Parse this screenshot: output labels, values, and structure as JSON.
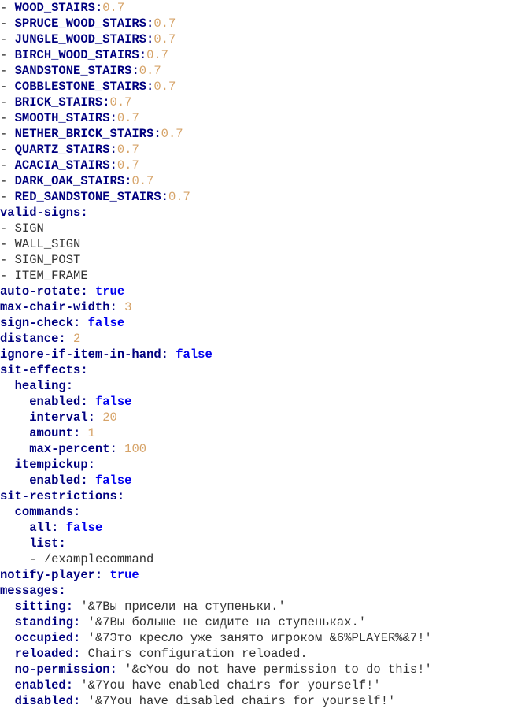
{
  "document": {
    "type": "yaml-config",
    "file_kind": "Chairs plugin configuration",
    "colors": {
      "key": "#000080",
      "boolean": "#0000ee",
      "number": "#d6a368",
      "string": "#333333",
      "background": "#ffffff"
    },
    "lines": [
      {
        "indent": 0,
        "bullet": "-",
        "key": "WOOD_STAIRS",
        "sep": ":",
        "value": "0.7",
        "vtype": "number"
      },
      {
        "indent": 0,
        "bullet": "-",
        "key": "SPRUCE_WOOD_STAIRS",
        "sep": ":",
        "value": "0.7",
        "vtype": "number"
      },
      {
        "indent": 0,
        "bullet": "-",
        "key": "JUNGLE_WOOD_STAIRS",
        "sep": ":",
        "value": "0.7",
        "vtype": "number"
      },
      {
        "indent": 0,
        "bullet": "-",
        "key": "BIRCH_WOOD_STAIRS",
        "sep": ":",
        "value": "0.7",
        "vtype": "number"
      },
      {
        "indent": 0,
        "bullet": "-",
        "key": "SANDSTONE_STAIRS",
        "sep": ":",
        "value": "0.7",
        "vtype": "number"
      },
      {
        "indent": 0,
        "bullet": "-",
        "key": "COBBLESTONE_STAIRS",
        "sep": ":",
        "value": "0.7",
        "vtype": "number"
      },
      {
        "indent": 0,
        "bullet": "-",
        "key": "BRICK_STAIRS",
        "sep": ":",
        "value": "0.7",
        "vtype": "number"
      },
      {
        "indent": 0,
        "bullet": "-",
        "key": "SMOOTH_STAIRS",
        "sep": ":",
        "value": "0.7",
        "vtype": "number"
      },
      {
        "indent": 0,
        "bullet": "-",
        "key": "NETHER_BRICK_STAIRS",
        "sep": ":",
        "value": "0.7",
        "vtype": "number"
      },
      {
        "indent": 0,
        "bullet": "-",
        "key": "QUARTZ_STAIRS",
        "sep": ":",
        "value": "0.7",
        "vtype": "number"
      },
      {
        "indent": 0,
        "bullet": "-",
        "key": "ACACIA_STAIRS",
        "sep": ":",
        "value": "0.7",
        "vtype": "number"
      },
      {
        "indent": 0,
        "bullet": "-",
        "key": "DARK_OAK_STAIRS",
        "sep": ":",
        "value": "0.7",
        "vtype": "number"
      },
      {
        "indent": 0,
        "bullet": "-",
        "key": "RED_SANDSTONE_STAIRS",
        "sep": ":",
        "value": "0.7",
        "vtype": "number"
      },
      {
        "indent": 0,
        "bullet": "",
        "key": "valid-signs",
        "sep": ":",
        "value": "",
        "vtype": "none"
      },
      {
        "indent": 0,
        "bullet": "-",
        "key": "",
        "sep": "",
        "value": "SIGN",
        "vtype": "item"
      },
      {
        "indent": 0,
        "bullet": "-",
        "key": "",
        "sep": "",
        "value": "WALL_SIGN",
        "vtype": "item"
      },
      {
        "indent": 0,
        "bullet": "-",
        "key": "",
        "sep": "",
        "value": "SIGN_POST",
        "vtype": "item"
      },
      {
        "indent": 0,
        "bullet": "-",
        "key": "",
        "sep": "",
        "value": "ITEM_FRAME",
        "vtype": "item"
      },
      {
        "indent": 0,
        "bullet": "",
        "key": "auto-rotate",
        "sep": ": ",
        "value": "true",
        "vtype": "boolean"
      },
      {
        "indent": 0,
        "bullet": "",
        "key": "max-chair-width",
        "sep": ": ",
        "value": "3",
        "vtype": "number"
      },
      {
        "indent": 0,
        "bullet": "",
        "key": "sign-check",
        "sep": ": ",
        "value": "false",
        "vtype": "boolean"
      },
      {
        "indent": 0,
        "bullet": "",
        "key": "distance",
        "sep": ": ",
        "value": "2",
        "vtype": "number"
      },
      {
        "indent": 0,
        "bullet": "",
        "key": "ignore-if-item-in-hand",
        "sep": ": ",
        "value": "false",
        "vtype": "boolean"
      },
      {
        "indent": 0,
        "bullet": "",
        "key": "sit-effects",
        "sep": ":",
        "value": "",
        "vtype": "none"
      },
      {
        "indent": 1,
        "bullet": "",
        "key": "healing",
        "sep": ":",
        "value": "",
        "vtype": "none"
      },
      {
        "indent": 2,
        "bullet": "",
        "key": "enabled",
        "sep": ": ",
        "value": "false",
        "vtype": "boolean"
      },
      {
        "indent": 2,
        "bullet": "",
        "key": "interval",
        "sep": ": ",
        "value": "20",
        "vtype": "number"
      },
      {
        "indent": 2,
        "bullet": "",
        "key": "amount",
        "sep": ": ",
        "value": "1",
        "vtype": "number"
      },
      {
        "indent": 2,
        "bullet": "",
        "key": "max-percent",
        "sep": ": ",
        "value": "100",
        "vtype": "number"
      },
      {
        "indent": 1,
        "bullet": "",
        "key": "itempickup",
        "sep": ":",
        "value": "",
        "vtype": "none"
      },
      {
        "indent": 2,
        "bullet": "",
        "key": "enabled",
        "sep": ": ",
        "value": "false",
        "vtype": "boolean"
      },
      {
        "indent": 0,
        "bullet": "",
        "key": "sit-restrictions",
        "sep": ":",
        "value": "",
        "vtype": "none"
      },
      {
        "indent": 1,
        "bullet": "",
        "key": "commands",
        "sep": ":",
        "value": "",
        "vtype": "none"
      },
      {
        "indent": 2,
        "bullet": "",
        "key": "all",
        "sep": ": ",
        "value": "false",
        "vtype": "boolean"
      },
      {
        "indent": 2,
        "bullet": "",
        "key": "list",
        "sep": ":",
        "value": "",
        "vtype": "none"
      },
      {
        "indent": 2,
        "bullet": "-",
        "key": "",
        "sep": "",
        "value": "/examplecommand",
        "vtype": "item"
      },
      {
        "indent": 0,
        "bullet": "",
        "key": "notify-player",
        "sep": ": ",
        "value": "true",
        "vtype": "boolean"
      },
      {
        "indent": 0,
        "bullet": "",
        "key": "messages",
        "sep": ":",
        "value": "",
        "vtype": "none"
      },
      {
        "indent": 1,
        "bullet": "",
        "key": "sitting",
        "sep": ": ",
        "value": "'&7Вы присели на ступеньки.'",
        "vtype": "string"
      },
      {
        "indent": 1,
        "bullet": "",
        "key": "standing",
        "sep": ": ",
        "value": "'&7Вы больше не сидите на ступеньках.'",
        "vtype": "string"
      },
      {
        "indent": 1,
        "bullet": "",
        "key": "occupied",
        "sep": ": ",
        "value": "'&7Это кресло уже занято игроком &6%PLAYER%&7!'",
        "vtype": "string"
      },
      {
        "indent": 1,
        "bullet": "",
        "key": "reloaded",
        "sep": ": ",
        "value": "Chairs configuration reloaded.",
        "vtype": "string"
      },
      {
        "indent": 1,
        "bullet": "",
        "key": "no-permission",
        "sep": ": ",
        "value": "'&cYou do not have permission to do this!'",
        "vtype": "string"
      },
      {
        "indent": 1,
        "bullet": "",
        "key": "enabled",
        "sep": ": ",
        "value": "'&7You have enabled chairs for yourself!'",
        "vtype": "string"
      },
      {
        "indent": 1,
        "bullet": "",
        "key": "disabled",
        "sep": ": ",
        "value": "'&7You have disabled chairs for yourself!'",
        "vtype": "string"
      }
    ]
  }
}
